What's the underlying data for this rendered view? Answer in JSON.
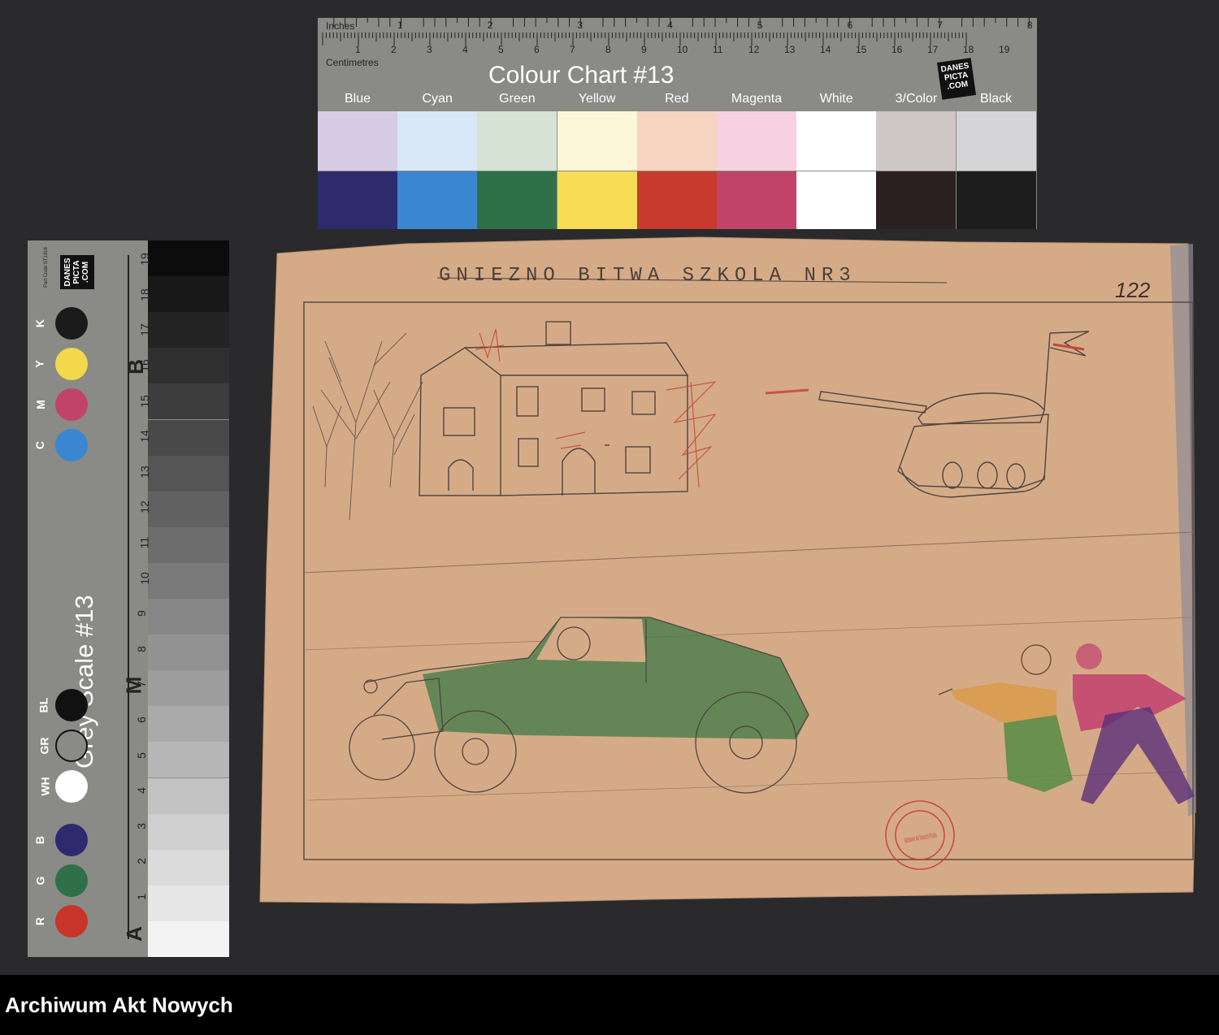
{
  "colour_chart": {
    "title": "Colour Chart #13",
    "inches_label": "Inches",
    "cm_label": "Centimetres",
    "inch_ticks": [
      "1",
      "2",
      "3",
      "4",
      "5",
      "6",
      "7",
      "8"
    ],
    "cm_ticks": [
      "1",
      "2",
      "3",
      "4",
      "5",
      "6",
      "7",
      "8",
      "9",
      "10",
      "11",
      "12",
      "13",
      "14",
      "15",
      "16",
      "17",
      "18",
      "19"
    ],
    "logo": "DANES PICTA .COM",
    "swatches": [
      {
        "name": "Blue",
        "light": "#d6cde4",
        "dark": "#2e2a6e"
      },
      {
        "name": "Cyan",
        "light": "#d9e6f5",
        "dark": "#3b86d0"
      },
      {
        "name": "Green",
        "light": "#d6e3d4",
        "dark": "#2f7048"
      },
      {
        "name": "Yellow",
        "light": "#fbf7d8",
        "dark": "#f7dc58"
      },
      {
        "name": "Red",
        "light": "#f7d3c1",
        "dark": "#c83a2e"
      },
      {
        "name": "Magenta",
        "light": "#f6d2e0",
        "dark": "#c2436a"
      },
      {
        "name": "White",
        "light": "#ffffff",
        "dark": "#ffffff"
      },
      {
        "name": "3/Color",
        "light": "#cdc7c6",
        "dark": "#2b2022"
      },
      {
        "name": "Black",
        "light": "#d5d5d8",
        "dark": "#1d1d1d"
      }
    ]
  },
  "grey_scale": {
    "title": "Grey Scale #13",
    "part_code": "Part Code ST1316",
    "logo": "DANES PICTA .COM",
    "numbers": [
      "1",
      "2",
      "3",
      "4",
      "5",
      "6",
      "7",
      "8",
      "9",
      "10",
      "11",
      "12",
      "13",
      "14",
      "15",
      "16",
      "17",
      "18",
      "19"
    ],
    "letters": {
      "a": "A",
      "m": "M",
      "b": "B"
    },
    "dots": [
      {
        "label": "R",
        "color": "#c8342a"
      },
      {
        "label": "G",
        "color": "#2f7048"
      },
      {
        "label": "B",
        "color": "#2e2a6e"
      },
      {
        "label": "WH",
        "color": "#ffffff"
      },
      {
        "label": "GR",
        "color": "#8a8a87"
      },
      {
        "label": "BL",
        "color": "#111111"
      },
      {
        "label": "C",
        "color": "#3b86d0"
      },
      {
        "label": "M",
        "color": "#c2436a"
      },
      {
        "label": "Y",
        "color": "#f2d84a"
      },
      {
        "label": "K",
        "color": "#1b1b1b"
      }
    ]
  },
  "drawing": {
    "title": "GNIEZNO BITWA SZKOLA NR3",
    "page_number": "122",
    "stamp_text": "Archiwum Akt Nowych Polska"
  },
  "footer": {
    "text": "Archiwum Akt Nowych"
  }
}
